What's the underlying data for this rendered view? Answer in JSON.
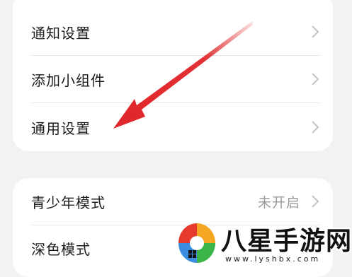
{
  "general_group": {
    "items": [
      {
        "label": "通知设置"
      },
      {
        "label": "添加小组件"
      },
      {
        "label": "通用设置"
      }
    ]
  },
  "mode_group": {
    "items": [
      {
        "label": "青少年模式",
        "value": "未开启"
      },
      {
        "label": "深色模式"
      }
    ]
  },
  "annotation": {
    "arrow_color": "#e0262a"
  },
  "watermark": {
    "name": "八星手游网",
    "url": "www.lyshbx.com",
    "logo_colors": [
      "#e63a2e",
      "#f5a623",
      "#3a8de0",
      "#3bb54a"
    ]
  }
}
